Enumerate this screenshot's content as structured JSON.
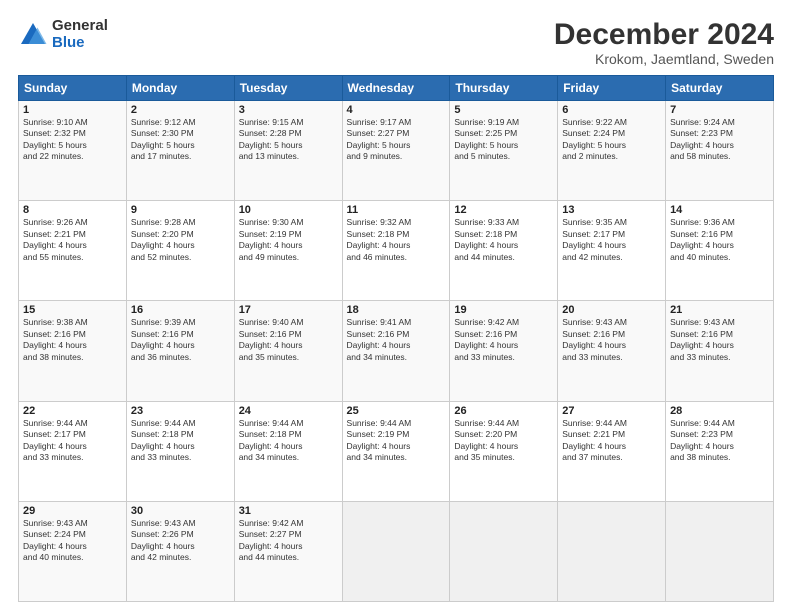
{
  "logo": {
    "general": "General",
    "blue": "Blue"
  },
  "title": "December 2024",
  "subtitle": "Krokom, Jaemtland, Sweden",
  "days": [
    "Sunday",
    "Monday",
    "Tuesday",
    "Wednesday",
    "Thursday",
    "Friday",
    "Saturday"
  ],
  "weeks": [
    [
      {
        "num": "1",
        "info": "Sunrise: 9:10 AM\nSunset: 2:32 PM\nDaylight: 5 hours\nand 22 minutes."
      },
      {
        "num": "2",
        "info": "Sunrise: 9:12 AM\nSunset: 2:30 PM\nDaylight: 5 hours\nand 17 minutes."
      },
      {
        "num": "3",
        "info": "Sunrise: 9:15 AM\nSunset: 2:28 PM\nDaylight: 5 hours\nand 13 minutes."
      },
      {
        "num": "4",
        "info": "Sunrise: 9:17 AM\nSunset: 2:27 PM\nDaylight: 5 hours\nand 9 minutes."
      },
      {
        "num": "5",
        "info": "Sunrise: 9:19 AM\nSunset: 2:25 PM\nDaylight: 5 hours\nand 5 minutes."
      },
      {
        "num": "6",
        "info": "Sunrise: 9:22 AM\nSunset: 2:24 PM\nDaylight: 5 hours\nand 2 minutes."
      },
      {
        "num": "7",
        "info": "Sunrise: 9:24 AM\nSunset: 2:23 PM\nDaylight: 4 hours\nand 58 minutes."
      }
    ],
    [
      {
        "num": "8",
        "info": "Sunrise: 9:26 AM\nSunset: 2:21 PM\nDaylight: 4 hours\nand 55 minutes."
      },
      {
        "num": "9",
        "info": "Sunrise: 9:28 AM\nSunset: 2:20 PM\nDaylight: 4 hours\nand 52 minutes."
      },
      {
        "num": "10",
        "info": "Sunrise: 9:30 AM\nSunset: 2:19 PM\nDaylight: 4 hours\nand 49 minutes."
      },
      {
        "num": "11",
        "info": "Sunrise: 9:32 AM\nSunset: 2:18 PM\nDaylight: 4 hours\nand 46 minutes."
      },
      {
        "num": "12",
        "info": "Sunrise: 9:33 AM\nSunset: 2:18 PM\nDaylight: 4 hours\nand 44 minutes."
      },
      {
        "num": "13",
        "info": "Sunrise: 9:35 AM\nSunset: 2:17 PM\nDaylight: 4 hours\nand 42 minutes."
      },
      {
        "num": "14",
        "info": "Sunrise: 9:36 AM\nSunset: 2:16 PM\nDaylight: 4 hours\nand 40 minutes."
      }
    ],
    [
      {
        "num": "15",
        "info": "Sunrise: 9:38 AM\nSunset: 2:16 PM\nDaylight: 4 hours\nand 38 minutes."
      },
      {
        "num": "16",
        "info": "Sunrise: 9:39 AM\nSunset: 2:16 PM\nDaylight: 4 hours\nand 36 minutes."
      },
      {
        "num": "17",
        "info": "Sunrise: 9:40 AM\nSunset: 2:16 PM\nDaylight: 4 hours\nand 35 minutes."
      },
      {
        "num": "18",
        "info": "Sunrise: 9:41 AM\nSunset: 2:16 PM\nDaylight: 4 hours\nand 34 minutes."
      },
      {
        "num": "19",
        "info": "Sunrise: 9:42 AM\nSunset: 2:16 PM\nDaylight: 4 hours\nand 33 minutes."
      },
      {
        "num": "20",
        "info": "Sunrise: 9:43 AM\nSunset: 2:16 PM\nDaylight: 4 hours\nand 33 minutes."
      },
      {
        "num": "21",
        "info": "Sunrise: 9:43 AM\nSunset: 2:16 PM\nDaylight: 4 hours\nand 33 minutes."
      }
    ],
    [
      {
        "num": "22",
        "info": "Sunrise: 9:44 AM\nSunset: 2:17 PM\nDaylight: 4 hours\nand 33 minutes."
      },
      {
        "num": "23",
        "info": "Sunrise: 9:44 AM\nSunset: 2:18 PM\nDaylight: 4 hours\nand 33 minutes."
      },
      {
        "num": "24",
        "info": "Sunrise: 9:44 AM\nSunset: 2:18 PM\nDaylight: 4 hours\nand 34 minutes."
      },
      {
        "num": "25",
        "info": "Sunrise: 9:44 AM\nSunset: 2:19 PM\nDaylight: 4 hours\nand 34 minutes."
      },
      {
        "num": "26",
        "info": "Sunrise: 9:44 AM\nSunset: 2:20 PM\nDaylight: 4 hours\nand 35 minutes."
      },
      {
        "num": "27",
        "info": "Sunrise: 9:44 AM\nSunset: 2:21 PM\nDaylight: 4 hours\nand 37 minutes."
      },
      {
        "num": "28",
        "info": "Sunrise: 9:44 AM\nSunset: 2:23 PM\nDaylight: 4 hours\nand 38 minutes."
      }
    ],
    [
      {
        "num": "29",
        "info": "Sunrise: 9:43 AM\nSunset: 2:24 PM\nDaylight: 4 hours\nand 40 minutes."
      },
      {
        "num": "30",
        "info": "Sunrise: 9:43 AM\nSunset: 2:26 PM\nDaylight: 4 hours\nand 42 minutes."
      },
      {
        "num": "31",
        "info": "Sunrise: 9:42 AM\nSunset: 2:27 PM\nDaylight: 4 hours\nand 44 minutes."
      },
      null,
      null,
      null,
      null
    ]
  ]
}
